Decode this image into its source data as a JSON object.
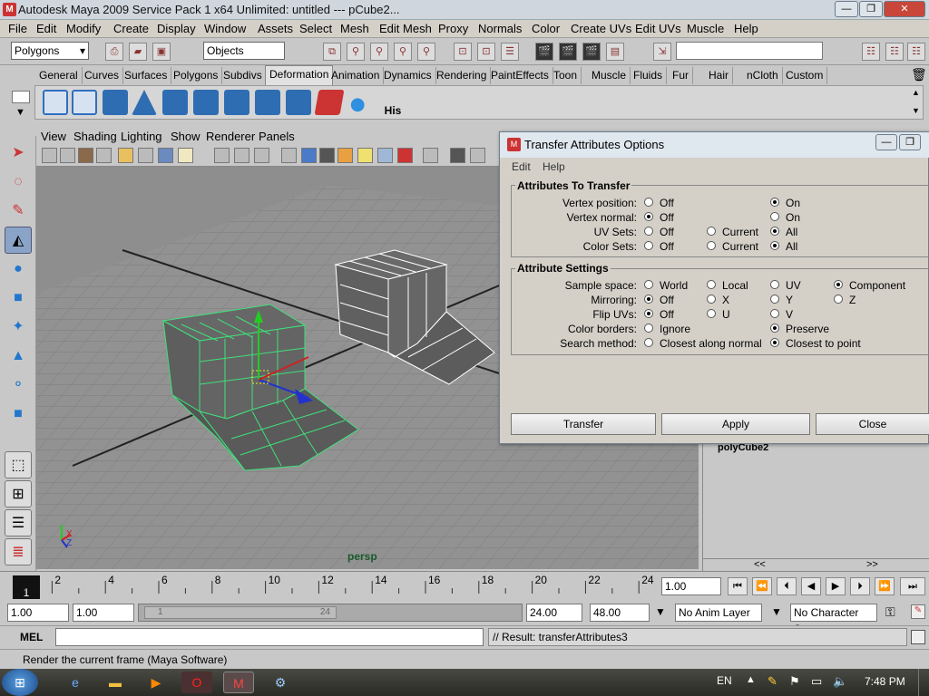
{
  "window": {
    "title": "Autodesk Maya 2009 Service Pack 1 x64 Unlimited: untitled   ---   pCube2..."
  },
  "menubar": [
    "File",
    "Edit",
    "Modify",
    "Create",
    "Display",
    "Window",
    "Assets",
    "Select",
    "Mesh",
    "Edit Mesh",
    "Proxy",
    "Normals",
    "Color",
    "Create UVs",
    "Edit UVs",
    "Muscle",
    "Help"
  ],
  "status": {
    "menuset": "Polygons",
    "selection_mode": "Objects"
  },
  "shelf": {
    "tabs": [
      "General",
      "Curves",
      "Surfaces",
      "Polygons",
      "Subdivs",
      "Deformation",
      "Animation",
      "Dynamics",
      "Rendering",
      "PaintEffects",
      "Toon",
      "Muscle",
      "Fluids",
      "Fur",
      "Hair",
      "nCloth",
      "Custom"
    ],
    "active_tab": "Deformation",
    "his_label": "His"
  },
  "viewport": {
    "menus": [
      "View",
      "Shading",
      "Lighting",
      "Show",
      "Renderer",
      "Panels"
    ],
    "camera_label": "persp",
    "axis_x": "X",
    "axis_z": "Z"
  },
  "dialog": {
    "title": "Transfer Attributes Options",
    "menu": [
      "Edit",
      "Help"
    ],
    "section1_title": "Attributes To Transfer",
    "section2_title": "Attribute Settings",
    "rows1": [
      {
        "label": "Vertex position:",
        "opt1": "Off",
        "opt2": "",
        "opt3": "On"
      },
      {
        "label": "Vertex normal:",
        "opt1": "Off",
        "opt2": "",
        "opt3": "On"
      },
      {
        "label": "UV Sets:",
        "opt1": "Off",
        "opt2": "Current",
        "opt3": "All"
      },
      {
        "label": "Color Sets:",
        "opt1": "Off",
        "opt2": "Current",
        "opt3": "All"
      }
    ],
    "sample_space": {
      "label": "Sample space:",
      "opts": [
        "World",
        "Local",
        "UV",
        "Component"
      ]
    },
    "mirroring": {
      "label": "Mirroring:",
      "opts": [
        "Off",
        "X",
        "Y",
        "Z"
      ]
    },
    "flip_uvs": {
      "label": "Flip UVs:",
      "opts": [
        "Off",
        "U",
        "V"
      ]
    },
    "color_borders": {
      "label": "Color borders:",
      "opts": [
        "Ignore",
        "Preserve"
      ]
    },
    "search_method": {
      "label": "Search method:",
      "opts": [
        "Closest along normal",
        "Closest to point"
      ]
    },
    "buttons": {
      "transfer": "Transfer",
      "apply": "Apply",
      "close": "Close"
    }
  },
  "channelbox": {
    "node": "polyCube2",
    "nav_left": "<<",
    "nav_right": ">>"
  },
  "timeline": {
    "ticks": [
      "2",
      "4",
      "6",
      "8",
      "10",
      "12",
      "14",
      "16",
      "18",
      "20",
      "22",
      "24"
    ],
    "current_frame": "1",
    "current_field": "1.00"
  },
  "range": {
    "start": "1.00",
    "playback_start": "1.00",
    "slider_start": "1",
    "slider_end": "24",
    "playback_end": "24.00",
    "end": "48.00",
    "anim_layer": "No Anim Layer",
    "char_set": "No Character Set"
  },
  "cmdline": {
    "label": "MEL",
    "result": "// Result: transferAttributes3"
  },
  "helpline": "Render the current frame (Maya Software)",
  "taskbar": {
    "lang": "EN",
    "time": "7:48 PM"
  }
}
